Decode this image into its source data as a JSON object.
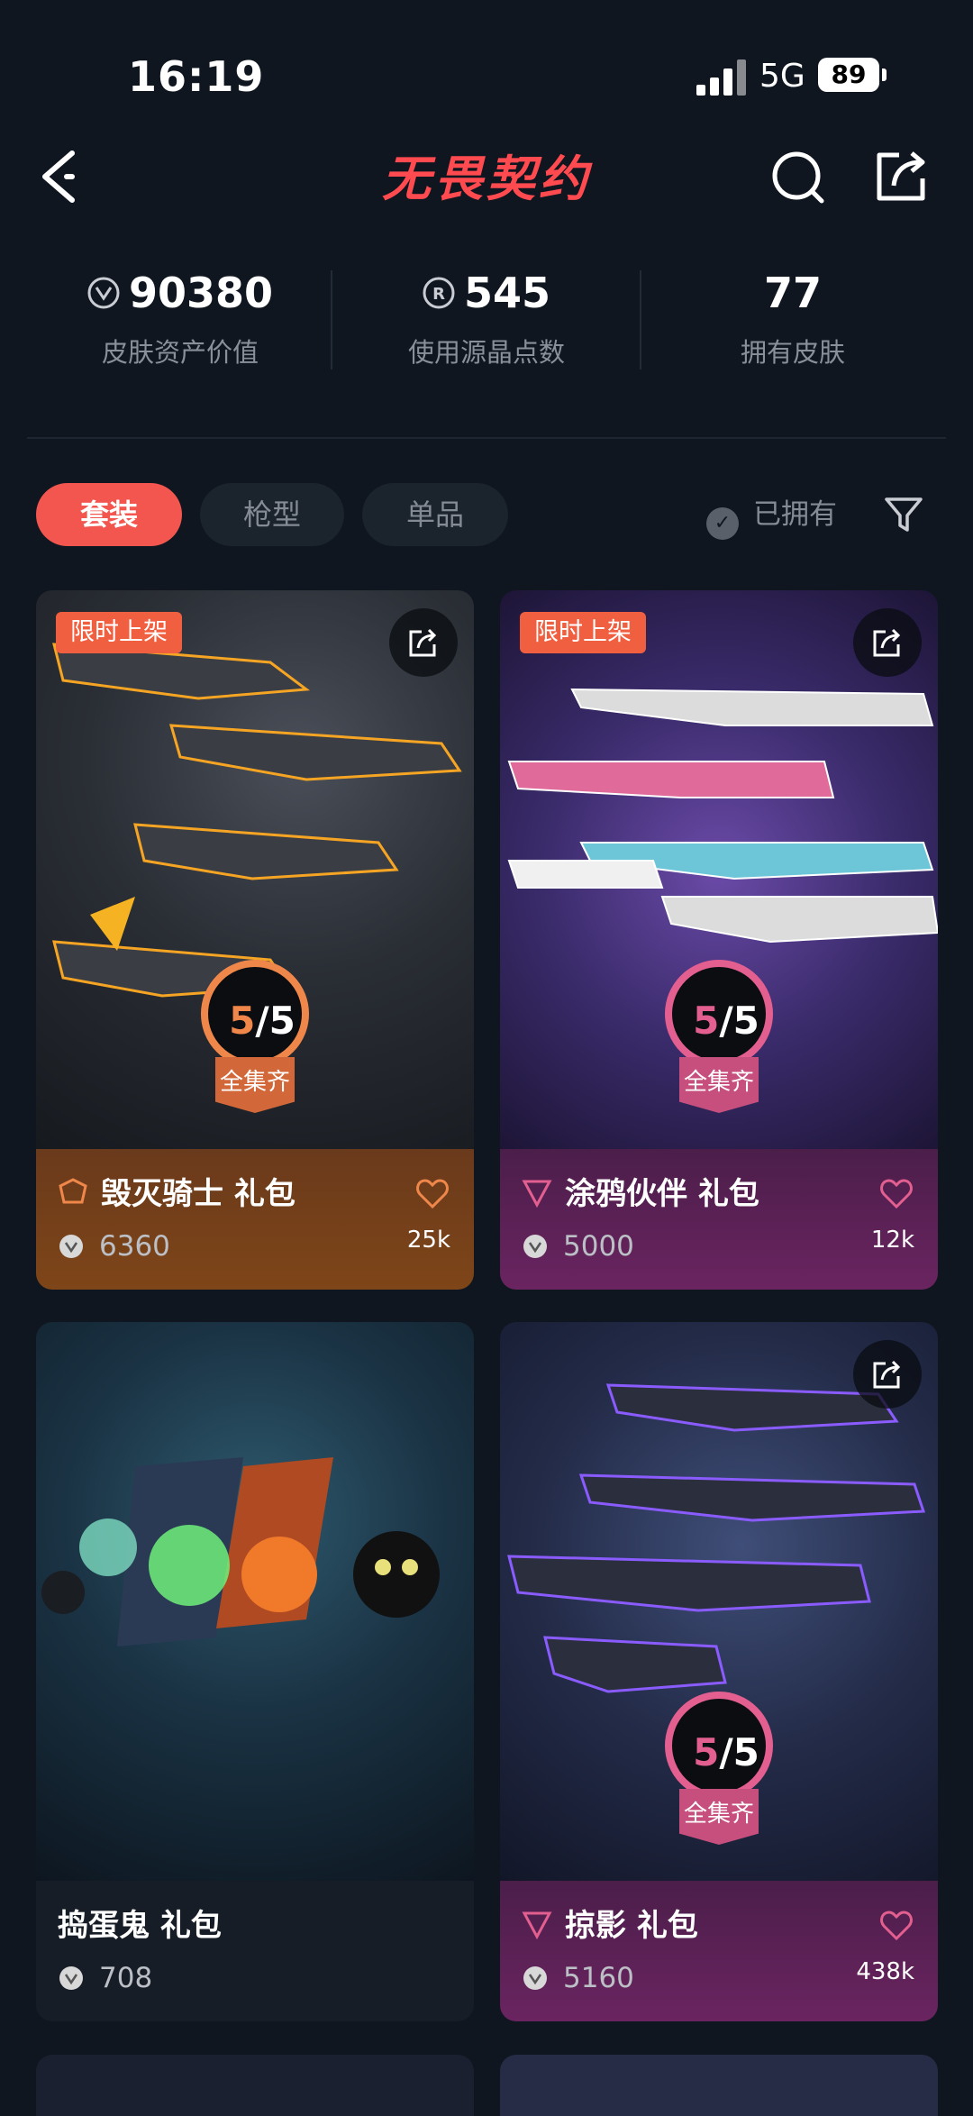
{
  "status_bar": {
    "time": "16:19",
    "network": "5G",
    "battery": "89"
  },
  "header": {
    "logo_text": "无畏契约"
  },
  "stats": [
    {
      "value": "90380",
      "label": "皮肤资产价值",
      "icon": "vp-coin-icon"
    },
    {
      "value": "545",
      "label": "使用源晶点数",
      "icon": "radianite-icon"
    },
    {
      "value": "77",
      "label": "拥有皮肤"
    }
  ],
  "filters": {
    "tabs": [
      "套装",
      "枪型",
      "单品"
    ],
    "active": "套装",
    "owned_label": "已拥有"
  },
  "cards": [
    {
      "tag": "限时上架",
      "title": "毁灭骑士 礼包",
      "price": "6360",
      "likes": "25k",
      "progress": "5/5",
      "progress_label": "全集齐",
      "tier_color": "#f0874a"
    },
    {
      "tag": "限时上架",
      "title": "涂鸦伙伴 礼包",
      "price": "5000",
      "likes": "12k",
      "progress": "5/5",
      "progress_label": "全集齐",
      "tier_color": "#e25f90"
    },
    {
      "title": "捣蛋鬼 礼包",
      "price": "708"
    },
    {
      "title": "掠影 礼包",
      "price": "5160",
      "likes": "438k",
      "progress": "5/5",
      "progress_label": "全集齐",
      "tier_color": "#e25f90"
    }
  ],
  "colors": {
    "accent": "#f2564f",
    "background": "#0f1620"
  }
}
